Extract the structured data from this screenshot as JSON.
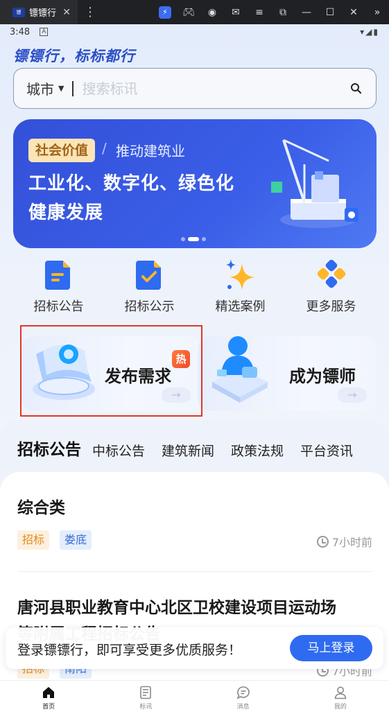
{
  "emulator": {
    "tab_title": "镖镖行",
    "app_icon_text": "镖",
    "close": "✕",
    "kebab": "⋮",
    "toolbar_icons": [
      "bolt-icon",
      "gamepad-icon",
      "account-icon",
      "mail-icon",
      "menu-icon",
      "screenshot-icon",
      "minimize-icon",
      "maximize-icon",
      "close-icon",
      "expand-icon"
    ]
  },
  "statusbar": {
    "time": "3:48",
    "a_badge": "A",
    "right": "▾◢▮"
  },
  "header": {
    "slogan": "镖镖行，标标都行"
  },
  "search": {
    "city": "城市",
    "placeholder": "搜索标讯"
  },
  "banner": {
    "tag": "社会价值",
    "sep": "/",
    "subtitle": "推动建筑业",
    "line1": "工业化、数字化、绿色化",
    "line2": "健康发展",
    "dots": 3,
    "active_dot": 1
  },
  "quick_menu": [
    {
      "label": "招标公告",
      "icon": "document-icon"
    },
    {
      "label": "招标公示",
      "icon": "check-document-icon"
    },
    {
      "label": "精选案例",
      "icon": "sparkle-icon"
    },
    {
      "label": "更多服务",
      "icon": "grid-dots-icon"
    }
  ],
  "cards": {
    "publish": {
      "title": "发布需求",
      "hot": "热",
      "arrow": "→"
    },
    "become": {
      "title": "成为镖师",
      "arrow": "→"
    }
  },
  "tabs": [
    "招标公告",
    "中标公告",
    "建筑新闻",
    "政策法规",
    "平台资讯"
  ],
  "list": [
    {
      "title": "综合类",
      "tags": [
        "招标",
        "娄底"
      ],
      "time": "7小时前"
    },
    {
      "title": "唐河县职业教育中心北区卫校建设项目运动场",
      "title_line2": "等附属工程招标公告",
      "tags": [
        "招标",
        "南阳"
      ],
      "time": "7小时前"
    }
  ],
  "login_prompt": {
    "text": "登录镖镖行，即可享受更多优质服务！",
    "button": "马上登录"
  },
  "tabbar": [
    {
      "label": "首页",
      "icon": "home-icon",
      "active": true
    },
    {
      "label": "标讯",
      "icon": "news-icon",
      "active": false
    },
    {
      "label": "消息",
      "icon": "message-icon",
      "active": false
    },
    {
      "label": "我的",
      "icon": "profile-icon",
      "active": false
    }
  ],
  "colors": {
    "brand": "#2f6bf0",
    "banner": "#3450d8",
    "highlight": "#e0352e",
    "hot": "#f24a2a"
  }
}
